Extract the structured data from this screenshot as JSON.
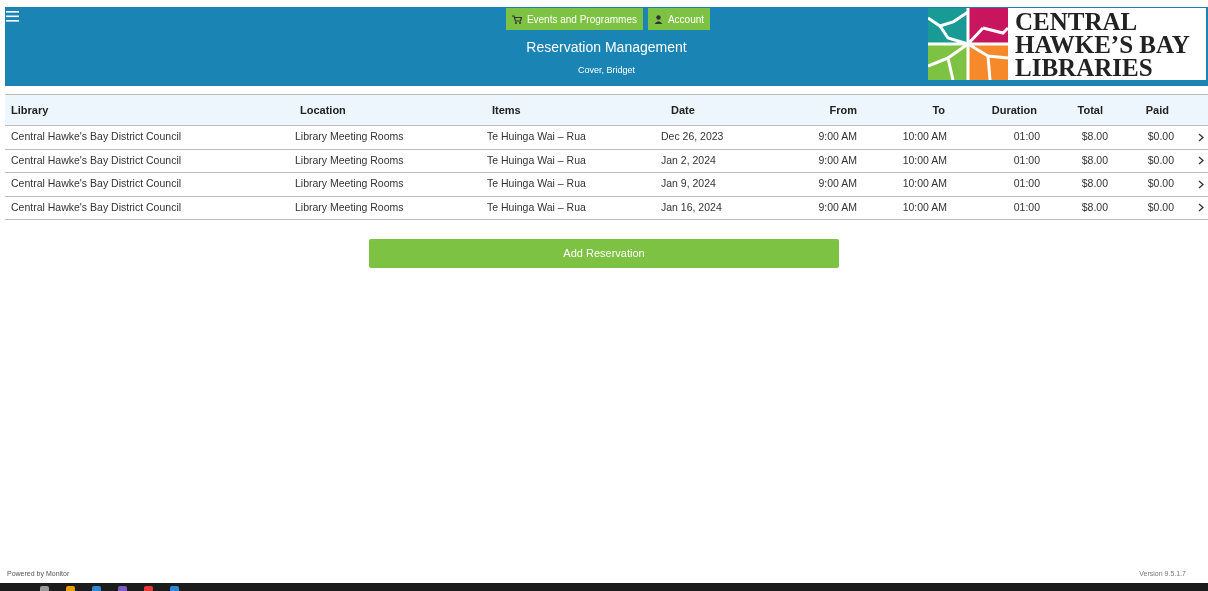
{
  "header": {
    "nav_buttons": [
      {
        "label": "Events and Programmes",
        "kind": "cart"
      },
      {
        "label": "Account",
        "kind": "person"
      }
    ],
    "title": "Reservation Management",
    "user": "Cover, Bridget",
    "logo_lines": [
      "CENTRAL",
      "HAWKE’S BAY",
      "LIBRARIES"
    ]
  },
  "table": {
    "columns": [
      "Library",
      "Location",
      "Items",
      "Date",
      "From",
      "To",
      "Duration",
      "Total",
      "Paid"
    ],
    "rows": [
      [
        "Central Hawke's Bay District Council",
        "Library Meeting Rooms",
        "Te Huinga Wai – Rua",
        "Dec 26, 2023",
        "9:00 AM",
        "10:00 AM",
        "01:00",
        "$8.00",
        "$0.00"
      ],
      [
        "Central Hawke's Bay District Council",
        "Library Meeting Rooms",
        "Te Huinga Wai – Rua",
        "Jan 2, 2024",
        "9:00 AM",
        "10:00 AM",
        "01:00",
        "$8.00",
        "$0.00"
      ],
      [
        "Central Hawke's Bay District Council",
        "Library Meeting Rooms",
        "Te Huinga Wai – Rua",
        "Jan 9, 2024",
        "9:00 AM",
        "10:00 AM",
        "01:00",
        "$8.00",
        "$0.00"
      ],
      [
        "Central Hawke's Bay District Council",
        "Library Meeting Rooms",
        "Te Huinga Wai – Rua",
        "Jan 16, 2024",
        "9:00 AM",
        "10:00 AM",
        "01:00",
        "$8.00",
        "$0.00"
      ]
    ]
  },
  "add_button": "Add Reservation",
  "footer": {
    "left": "Powered by Monitor",
    "right": "Version 9.5.1.7"
  }
}
